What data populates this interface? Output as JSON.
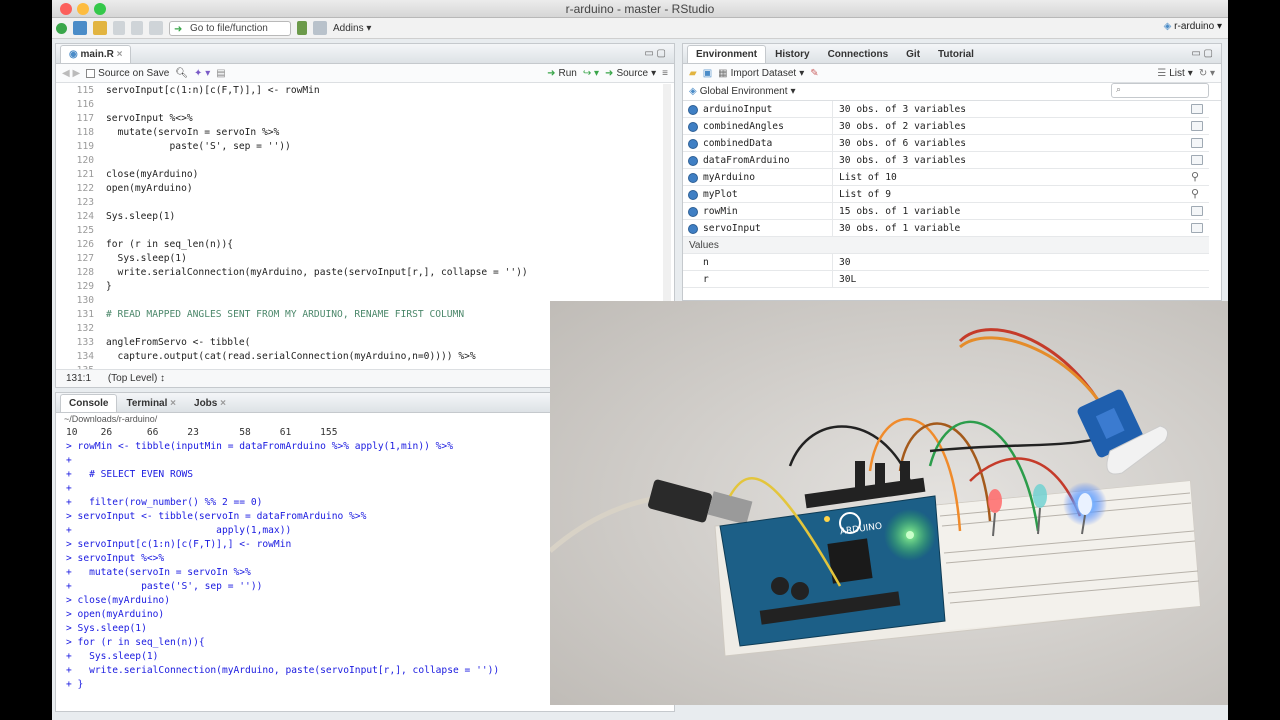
{
  "window": {
    "title": "r-arduino - master - RStudio"
  },
  "toolbar": {
    "goto_placeholder": "Go to file/function",
    "addins": "Addins",
    "project": "r-arduino"
  },
  "editor": {
    "tab": "main.R",
    "source_on_save": "Source on Save",
    "run": "Run",
    "source": "Source",
    "line_numbers": [
      "115",
      "116",
      "117",
      "118",
      "119",
      "120",
      "121",
      "122",
      "123",
      "124",
      "125",
      "126",
      "127",
      "128",
      "129",
      "130",
      "131",
      "132",
      "133",
      "134",
      "135"
    ],
    "lines": [
      "servoInput[c(1:n)[c(F,T)],] <- rowMin",
      "",
      "servoInput %<>%",
      "  mutate(servoIn = servoIn %>%",
      "           paste('S', sep = ''))",
      "",
      "close(myArduino)",
      "open(myArduino)",
      "",
      "Sys.sleep(1)",
      "",
      "for (r in seq_len(n)){",
      "  Sys.sleep(1)",
      "  write.serialConnection(myArduino, paste(servoInput[r,], collapse = ''))",
      "}",
      "",
      "# READ MAPPED ANGLES SENT FROM MY ARDUINO, RENAME FIRST COLUMN",
      "",
      "angleFromServo <- tibble(",
      "  capture.output(cat(read.serialConnection(myArduino,n=0)))) %>%",
      ""
    ],
    "status_pos": "131:1",
    "status_scope": "(Top Level) ↕"
  },
  "console": {
    "tabs": [
      "Console",
      "Terminal",
      "Jobs"
    ],
    "path": "~/Downloads/r-arduino/",
    "lines": [
      "10    26      66     23       58     61     155",
      "> rowMin <- tibble(inputMin = dataFromArduino %>% apply(1,min)) %>%",
      "+",
      "+   # SELECT EVEN ROWS",
      "+",
      "+   filter(row_number() %% 2 == 0)",
      "> servoInput <- tibble(servoIn = dataFromArduino %>%",
      "+                         apply(1,max))",
      "> servoInput[c(1:n)[c(F,T)],] <- rowMin",
      "> servoInput %<>%",
      "+   mutate(servoIn = servoIn %>%",
      "+            paste('S', sep = ''))",
      "> close(myArduino)",
      "> open(myArduino)",
      "> Sys.sleep(1)",
      "> for (r in seq_len(n)){",
      "+   Sys.sleep(1)",
      "+   write.serialConnection(myArduino, paste(servoInput[r,], collapse = ''))",
      "+ }"
    ]
  },
  "environment": {
    "tabs": [
      "Environment",
      "History",
      "Connections",
      "Git",
      "Tutorial"
    ],
    "import": "Import Dataset",
    "view": "List",
    "scope": "Global Environment",
    "values_header": "Values",
    "data": [
      {
        "name": "arduinoInput",
        "value": "30 obs. of 3 variables",
        "icon": "grid-icon"
      },
      {
        "name": "combinedAngles",
        "value": "30 obs. of 2 variables",
        "icon": "grid-icon"
      },
      {
        "name": "combinedData",
        "value": "30 obs. of 6 variables",
        "icon": "grid-icon"
      },
      {
        "name": "dataFromArduino",
        "value": "30 obs. of 3 variables",
        "icon": "grid-icon"
      },
      {
        "name": "myArduino",
        "value": "List of 10",
        "icon": "magnifier-icon"
      },
      {
        "name": "myPlot",
        "value": "List of 9",
        "icon": "magnifier-icon"
      },
      {
        "name": "rowMin",
        "value": "15 obs. of 1 variable",
        "icon": "grid-icon"
      },
      {
        "name": "servoInput",
        "value": "30 obs. of 1 variable",
        "icon": "grid-icon"
      }
    ],
    "values": [
      {
        "name": "n",
        "value": "30"
      },
      {
        "name": "r",
        "value": "30L"
      }
    ]
  },
  "photo": {
    "board_text": "ARDUINO"
  }
}
